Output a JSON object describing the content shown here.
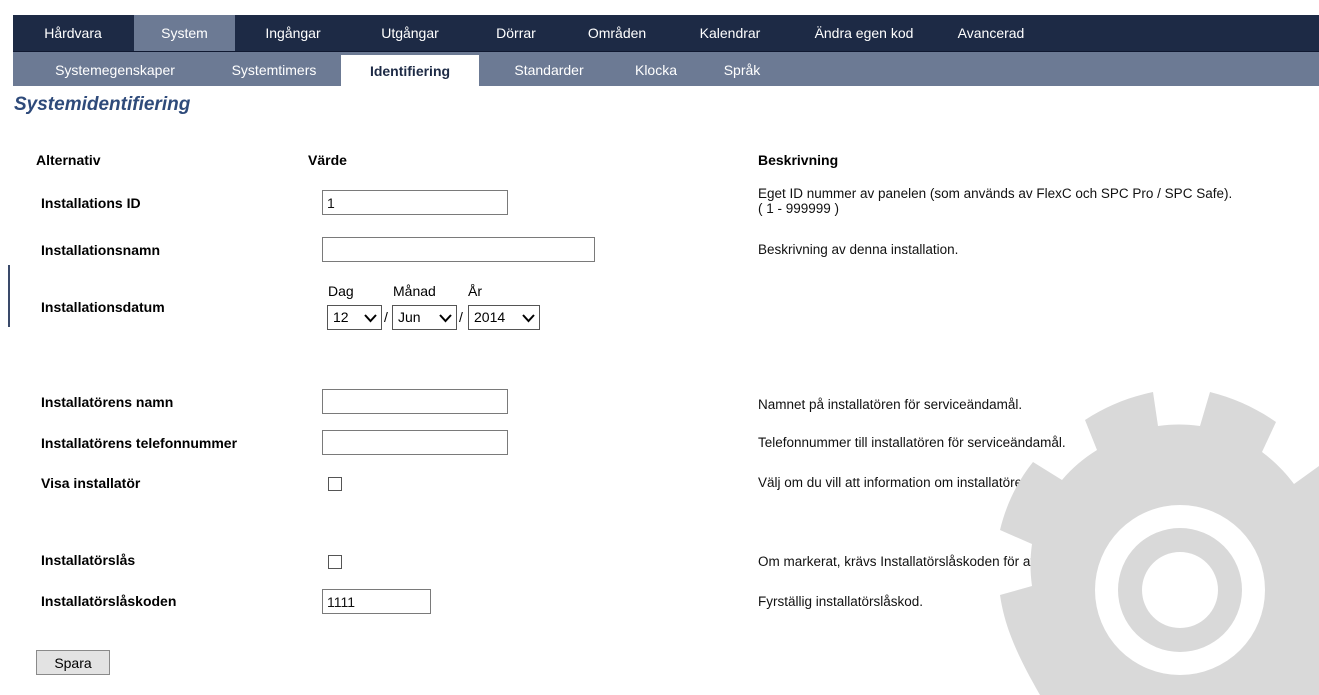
{
  "top_nav": {
    "tabs": [
      {
        "label": "Hårdvara",
        "active": false
      },
      {
        "label": "System",
        "active": true
      },
      {
        "label": "Ingångar",
        "active": false
      },
      {
        "label": "Utgångar",
        "active": false
      },
      {
        "label": "Dörrar",
        "active": false
      },
      {
        "label": "Områden",
        "active": false
      },
      {
        "label": "Kalendrar",
        "active": false
      },
      {
        "label": "Ändra egen kod",
        "active": false
      },
      {
        "label": "Avancerad",
        "active": false
      }
    ]
  },
  "sub_nav": {
    "tabs": [
      {
        "label": "Systemegenskaper",
        "active": false
      },
      {
        "label": "Systemtimers",
        "active": false
      },
      {
        "label": "Identifiering",
        "active": true
      },
      {
        "label": "Standarder",
        "active": false
      },
      {
        "label": "Klocka",
        "active": false
      },
      {
        "label": "Språk",
        "active": false
      }
    ]
  },
  "page": {
    "title": "Systemidentifiering",
    "headers": {
      "option": "Alternativ",
      "value": "Värde",
      "description": "Beskrivning"
    }
  },
  "fields": {
    "installation_id": {
      "label": "Installations ID",
      "value": "1",
      "description_line1": "Eget ID nummer av panelen (som används av FlexC och SPC Pro / SPC Safe).",
      "description_line2": "( 1 - 999999 )"
    },
    "installation_name": {
      "label": "Installationsnamn",
      "value": "",
      "description": "Beskrivning av denna installation."
    },
    "installation_date": {
      "label": "Installationsdatum",
      "day_label": "Dag",
      "month_label": "Månad",
      "year_label": "År",
      "day": "12",
      "month": "Jun",
      "year": "2014",
      "separator": "/"
    },
    "installer_name": {
      "label": "Installatörens namn",
      "value": "",
      "description": "Namnet på installatören för serviceändamål."
    },
    "installer_phone": {
      "label": "Installatörens telefonnummer",
      "value": "",
      "description": "Telefonnummer till installatören för serviceändamål."
    },
    "show_installer": {
      "label": "Visa installatör",
      "checked": false,
      "description": "Välj om du vill att information om installatören ska visas i teckenfönster."
    },
    "installer_lock": {
      "label": "Installatörslås",
      "checked": false,
      "description": "Om markerat, krävs Installatörslåskoden för att fabriksåterställa centralen."
    },
    "installer_lock_code": {
      "label": "Installatörslåskoden",
      "value": "1111",
      "description": "Fyrställig installatörslåskod."
    }
  },
  "actions": {
    "save_label": "Spara"
  },
  "colors": {
    "top_nav_bg": "#1d2a45",
    "sub_nav_bg": "#6c7a94",
    "title": "#2e4a7a",
    "watermark": "#d9d9d9"
  },
  "icons": {
    "watermark": "gear-icon",
    "dropdown": "chevron-down-icon"
  }
}
